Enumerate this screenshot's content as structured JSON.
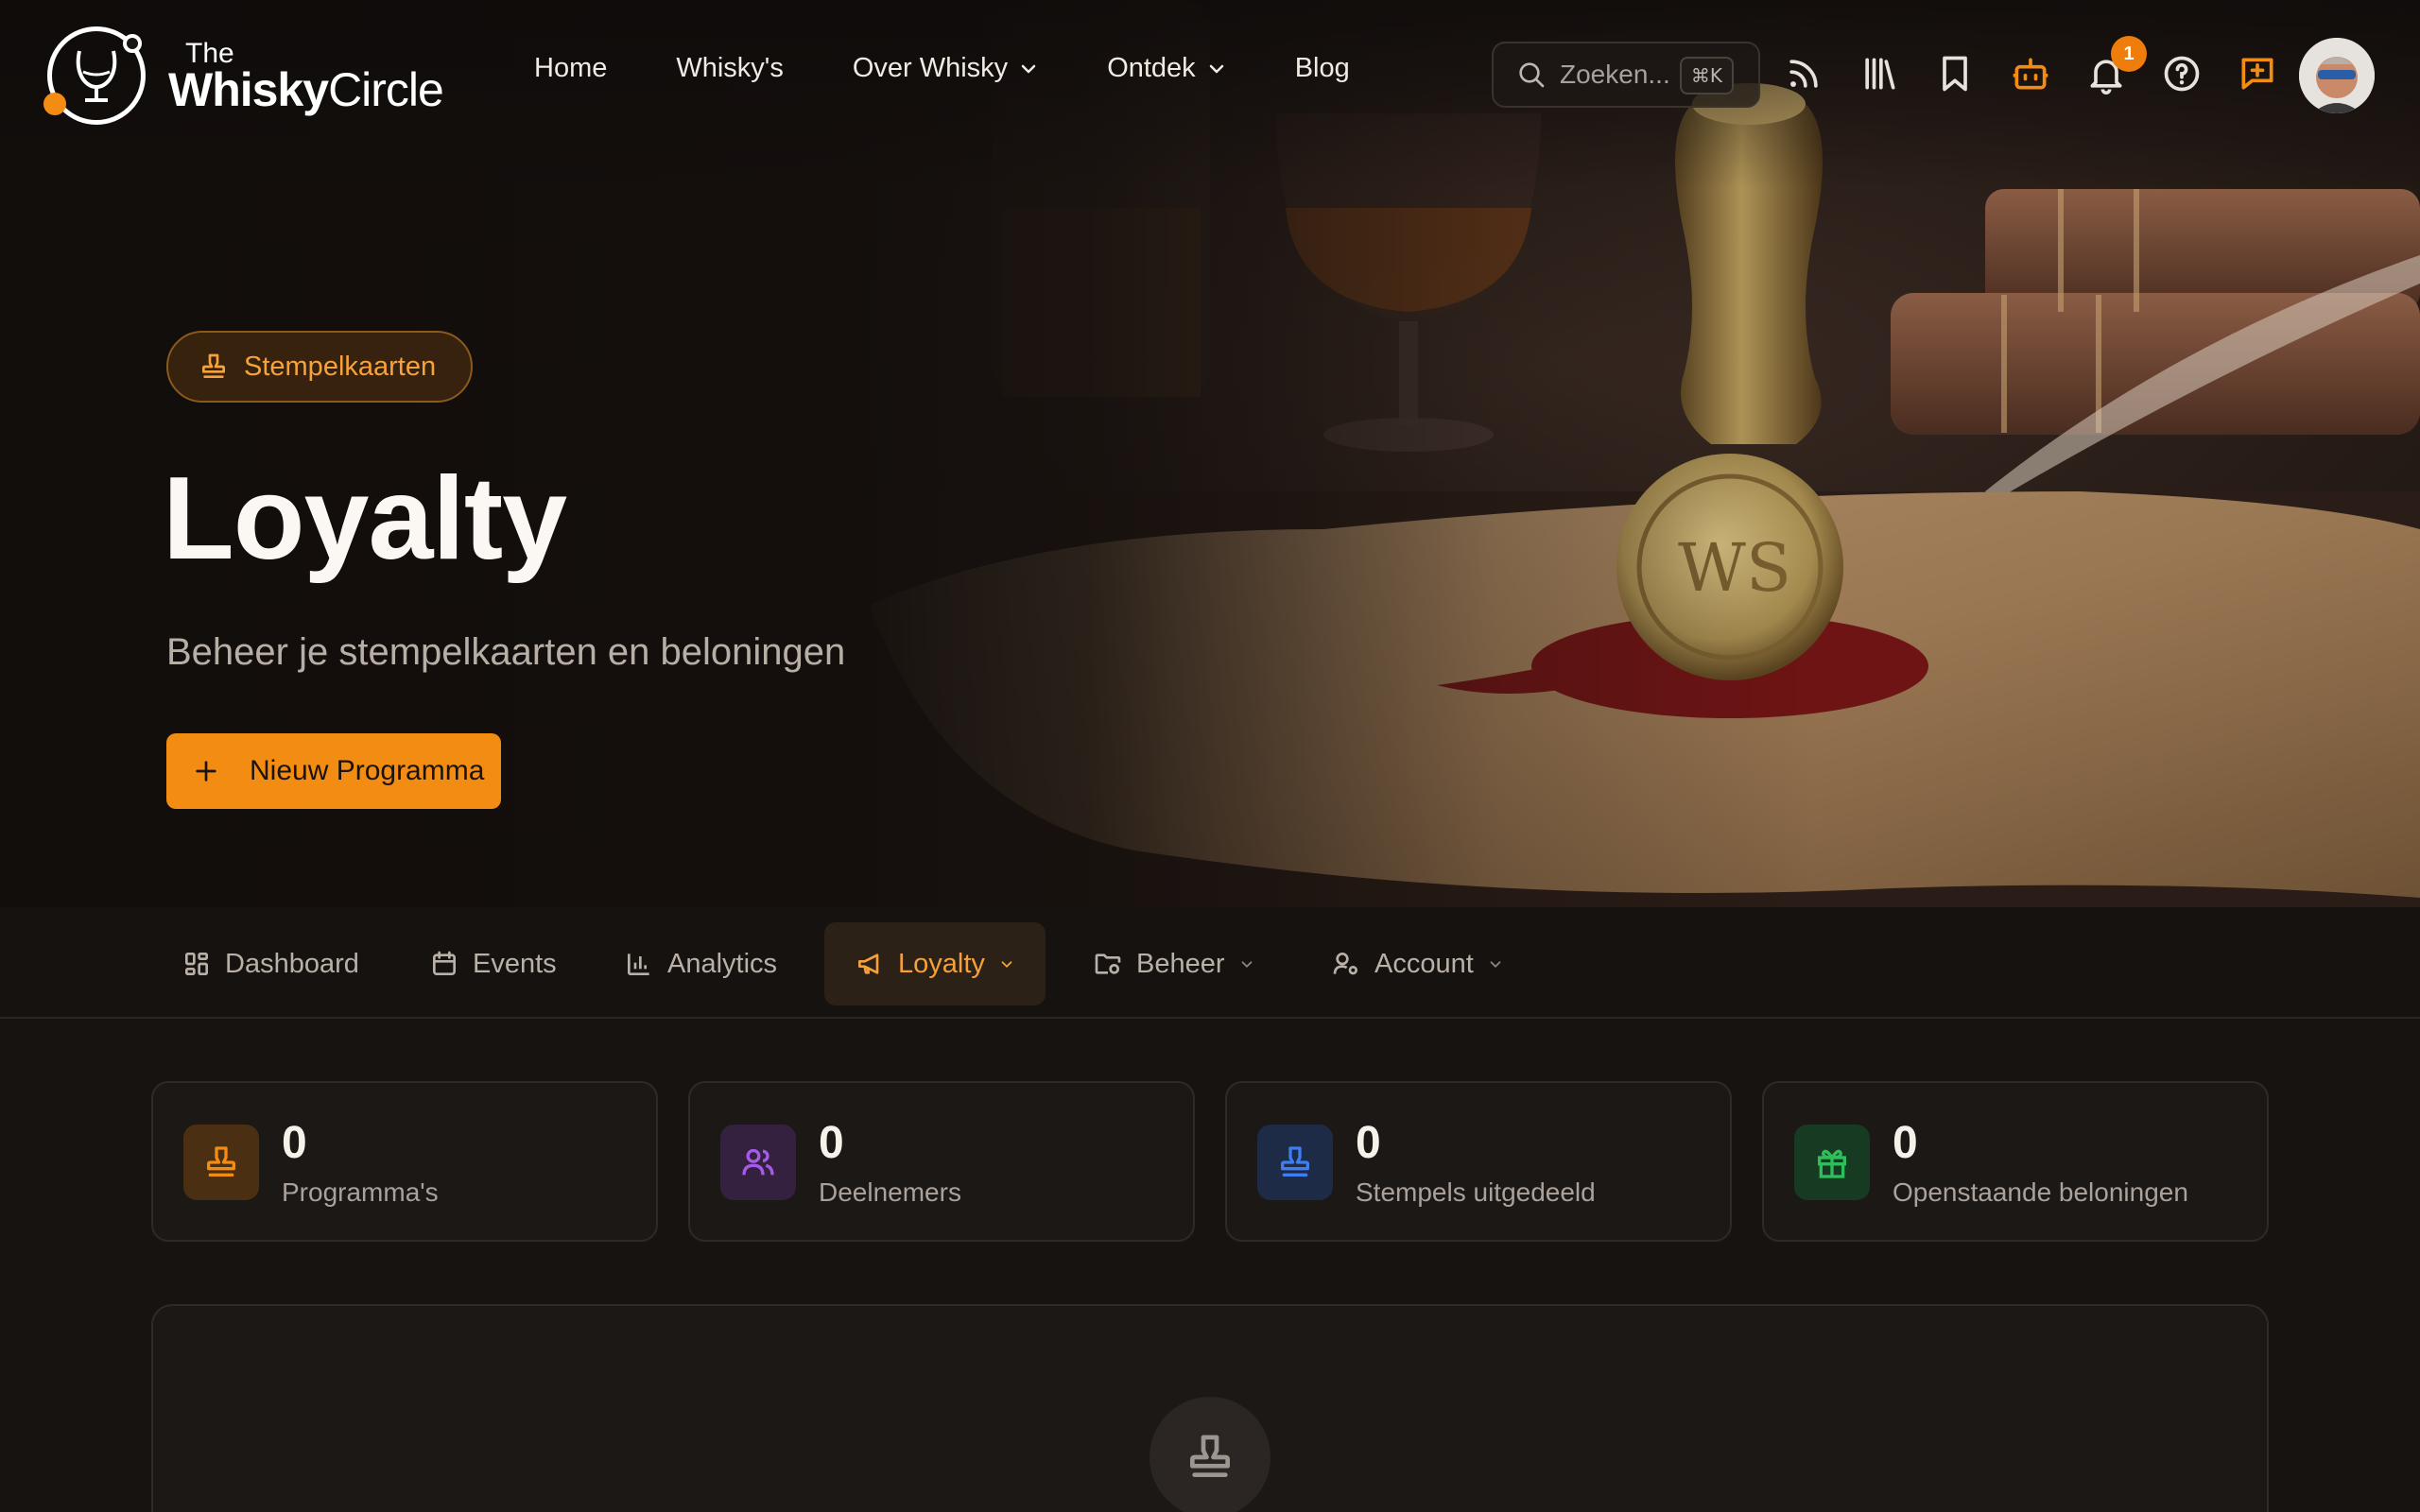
{
  "brand": {
    "the": "The",
    "name_bold": "Whisky",
    "name_light": "Circle"
  },
  "nav": {
    "items": [
      {
        "label": "Home",
        "dropdown": false
      },
      {
        "label": "Whisky's",
        "dropdown": false
      },
      {
        "label": "Over Whisky",
        "dropdown": true
      },
      {
        "label": "Ontdek",
        "dropdown": true
      },
      {
        "label": "Blog",
        "dropdown": false
      }
    ]
  },
  "search": {
    "placeholder": "Zoeken...",
    "shortcut": "⌘K"
  },
  "header_icons": [
    "rss-icon",
    "library-icon",
    "bookmark-icon",
    "bot-icon",
    "bell-icon",
    "help-icon",
    "message-plus-icon"
  ],
  "notifications": {
    "count": "1"
  },
  "hero": {
    "pill_label": "Stempelkaarten",
    "title": "Loyalty",
    "subtitle": "Beheer je stempelkaarten en beloningen",
    "cta_label": "Nieuw Programma"
  },
  "tabs": [
    {
      "label": "Dashboard",
      "icon": "dashboard-icon",
      "active": false,
      "dropdown": false
    },
    {
      "label": "Events",
      "icon": "calendar-icon",
      "active": false,
      "dropdown": false
    },
    {
      "label": "Analytics",
      "icon": "bar-chart-icon",
      "active": false,
      "dropdown": false
    },
    {
      "label": "Loyalty",
      "icon": "megaphone-icon",
      "active": true,
      "dropdown": true
    },
    {
      "label": "Beheer",
      "icon": "folder-settings-icon",
      "active": false,
      "dropdown": true
    },
    {
      "label": "Account",
      "icon": "user-settings-icon",
      "active": false,
      "dropdown": true
    }
  ],
  "stats": [
    {
      "value": "0",
      "label": "Programma's",
      "icon": "stamp-icon",
      "color": "#f28c13",
      "bg": "#4a2f12"
    },
    {
      "value": "0",
      "label": "Deelnemers",
      "icon": "users-icon",
      "color": "#a65be8",
      "bg": "#34203f"
    },
    {
      "value": "0",
      "label": "Stempels uitgedeeld",
      "icon": "stamp-icon",
      "color": "#3d7ef0",
      "bg": "#1e2b47"
    },
    {
      "value": "0",
      "label": "Openstaande beloningen",
      "icon": "gift-icon",
      "color": "#2fbf5a",
      "bg": "#173a22"
    }
  ],
  "colors": {
    "accent": "#f28c13",
    "background": "#161311",
    "card": "#1b1816"
  }
}
